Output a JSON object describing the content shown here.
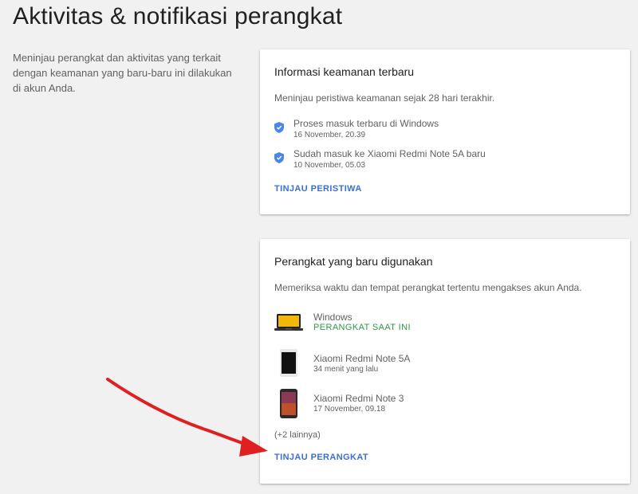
{
  "page": {
    "title": "Aktivitas & notifikasi perangkat",
    "intro": "Meninjau perangkat dan aktivitas yang terkait dengan keamanan yang baru-baru ini dilakukan di akun Anda."
  },
  "security_card": {
    "title": "Informasi keamanan terbaru",
    "description": "Meninjau peristiwa keamanan sejak 28 hari terakhir.",
    "events": [
      {
        "icon": "shield-icon",
        "label": "Proses masuk terbaru di Windows",
        "time": "16 November, 20.39"
      },
      {
        "icon": "shield-icon",
        "label": "Sudah masuk ke Xiaomi Redmi Note 5A baru",
        "time": "10 November, 05.03"
      }
    ],
    "action_label": "TINJAU PERISTIWA"
  },
  "devices_card": {
    "title": "Perangkat yang baru digunakan",
    "description": "Memeriksa waktu dan tempat perangkat tertentu mengakses akun Anda.",
    "devices": [
      {
        "icon": "laptop-icon",
        "name": "Windows",
        "status": "PERANGKAT SAAT INI"
      },
      {
        "icon": "phone-icon",
        "name": "Xiaomi Redmi Note 5A",
        "time": "34 menit yang lalu"
      },
      {
        "icon": "phone-icon",
        "name": "Xiaomi Redmi Note 3",
        "time": "17 November, 09.18"
      }
    ],
    "more_label": "(+2 lainnya)",
    "action_label": "TINJAU PERANGKAT"
  },
  "colors": {
    "link": "#3b6fd6",
    "current_device": "#2e9a47",
    "shield": "#4a86e8",
    "annotation_arrow": "#e02020"
  }
}
